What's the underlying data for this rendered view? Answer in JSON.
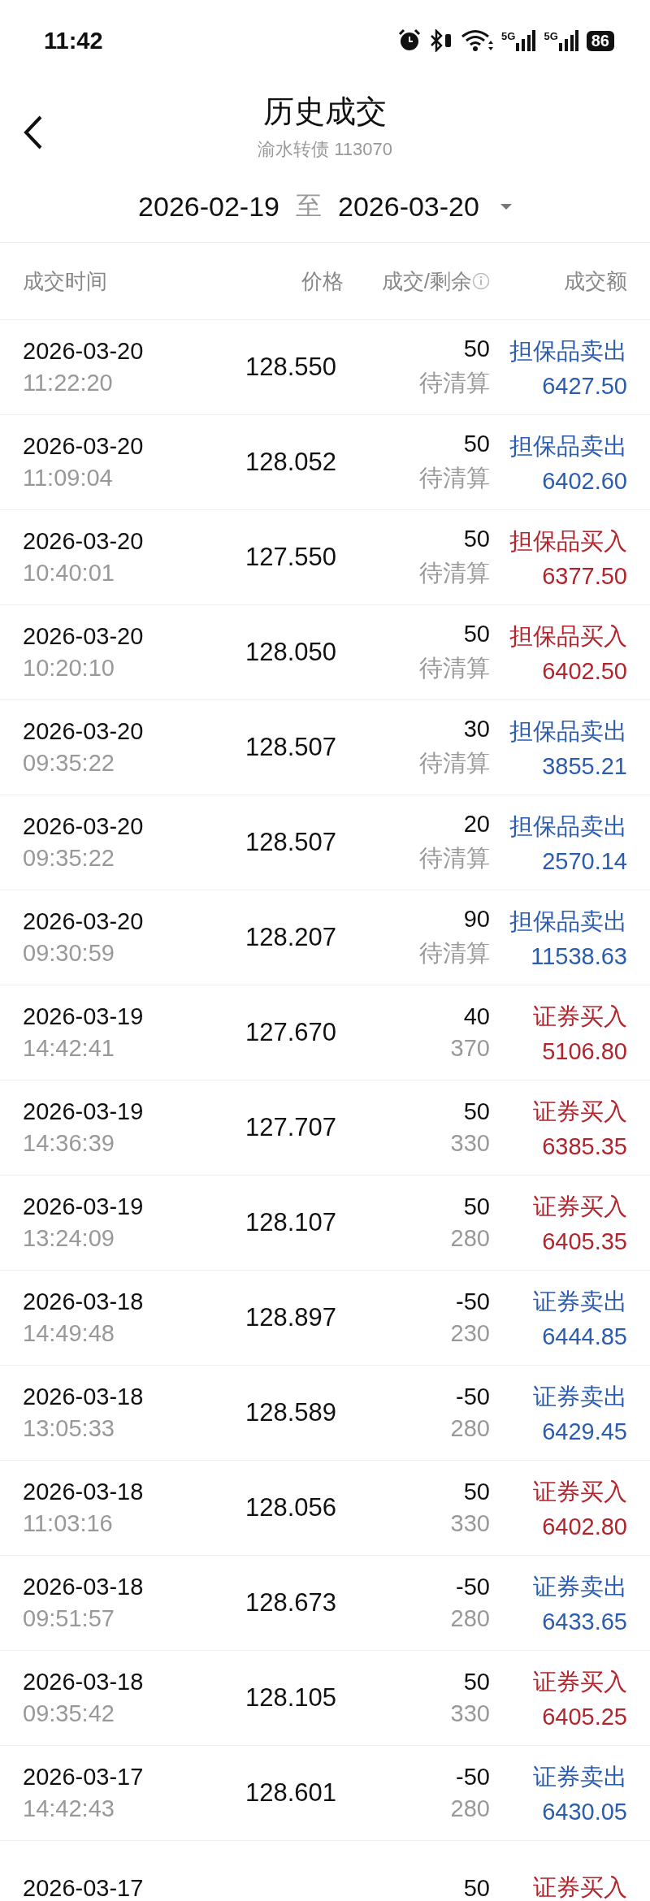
{
  "status_bar": {
    "time": "11:42",
    "network_1": "5G",
    "network_2": "5G",
    "battery": "86"
  },
  "header": {
    "title": "历史成交",
    "subtitle": "渝水转债 113070"
  },
  "date_range": {
    "start": "2026-02-19",
    "separator": "至",
    "end": "2026-03-20"
  },
  "table": {
    "columns": [
      "成交时间",
      "价格",
      "成交/剩余",
      "成交额"
    ],
    "rows": [
      {
        "date": "2026-03-20",
        "time": "11:22:20",
        "price": "128.550",
        "quantity": "50",
        "remaining": "待清算",
        "kind": "sell",
        "type": "担保品卖出",
        "amount": "6427.50"
      },
      {
        "date": "2026-03-20",
        "time": "11:09:04",
        "price": "128.052",
        "quantity": "50",
        "remaining": "待清算",
        "kind": "sell",
        "type": "担保品卖出",
        "amount": "6402.60"
      },
      {
        "date": "2026-03-20",
        "time": "10:40:01",
        "price": "127.550",
        "quantity": "50",
        "remaining": "待清算",
        "kind": "buy",
        "type": "担保品买入",
        "amount": "6377.50"
      },
      {
        "date": "2026-03-20",
        "time": "10:20:10",
        "price": "128.050",
        "quantity": "50",
        "remaining": "待清算",
        "kind": "buy",
        "type": "担保品买入",
        "amount": "6402.50"
      },
      {
        "date": "2026-03-20",
        "time": "09:35:22",
        "price": "128.507",
        "quantity": "30",
        "remaining": "待清算",
        "kind": "sell",
        "type": "担保品卖出",
        "amount": "3855.21"
      },
      {
        "date": "2026-03-20",
        "time": "09:35:22",
        "price": "128.507",
        "quantity": "20",
        "remaining": "待清算",
        "kind": "sell",
        "type": "担保品卖出",
        "amount": "2570.14"
      },
      {
        "date": "2026-03-20",
        "time": "09:30:59",
        "price": "128.207",
        "quantity": "90",
        "remaining": "待清算",
        "kind": "sell",
        "type": "担保品卖出",
        "amount": "11538.63"
      },
      {
        "date": "2026-03-19",
        "time": "14:42:41",
        "price": "127.670",
        "quantity": "40",
        "remaining": "370",
        "kind": "buy",
        "type": "证券买入",
        "amount": "5106.80"
      },
      {
        "date": "2026-03-19",
        "time": "14:36:39",
        "price": "127.707",
        "quantity": "50",
        "remaining": "330",
        "kind": "buy",
        "type": "证券买入",
        "amount": "6385.35"
      },
      {
        "date": "2026-03-19",
        "time": "13:24:09",
        "price": "128.107",
        "quantity": "50",
        "remaining": "280",
        "kind": "buy",
        "type": "证券买入",
        "amount": "6405.35"
      },
      {
        "date": "2026-03-18",
        "time": "14:49:48",
        "price": "128.897",
        "quantity": "-50",
        "remaining": "230",
        "kind": "sell",
        "type": "证券卖出",
        "amount": "6444.85"
      },
      {
        "date": "2026-03-18",
        "time": "13:05:33",
        "price": "128.589",
        "quantity": "-50",
        "remaining": "280",
        "kind": "sell",
        "type": "证券卖出",
        "amount": "6429.45"
      },
      {
        "date": "2026-03-18",
        "time": "11:03:16",
        "price": "128.056",
        "quantity": "50",
        "remaining": "330",
        "kind": "buy",
        "type": "证券买入",
        "amount": "6402.80"
      },
      {
        "date": "2026-03-18",
        "time": "09:51:57",
        "price": "128.673",
        "quantity": "-50",
        "remaining": "280",
        "kind": "sell",
        "type": "证券卖出",
        "amount": "6433.65"
      },
      {
        "date": "2026-03-18",
        "time": "09:35:42",
        "price": "128.105",
        "quantity": "50",
        "remaining": "330",
        "kind": "buy",
        "type": "证券买入",
        "amount": "6405.25"
      },
      {
        "date": "2026-03-17",
        "time": "14:42:43",
        "price": "128.601",
        "quantity": "-50",
        "remaining": "280",
        "kind": "sell",
        "type": "证券卖出",
        "amount": "6430.05"
      },
      {
        "date": "2026-03-17",
        "quantity": "50",
        "kind": "buy",
        "type": "证券买入"
      }
    ]
  }
}
